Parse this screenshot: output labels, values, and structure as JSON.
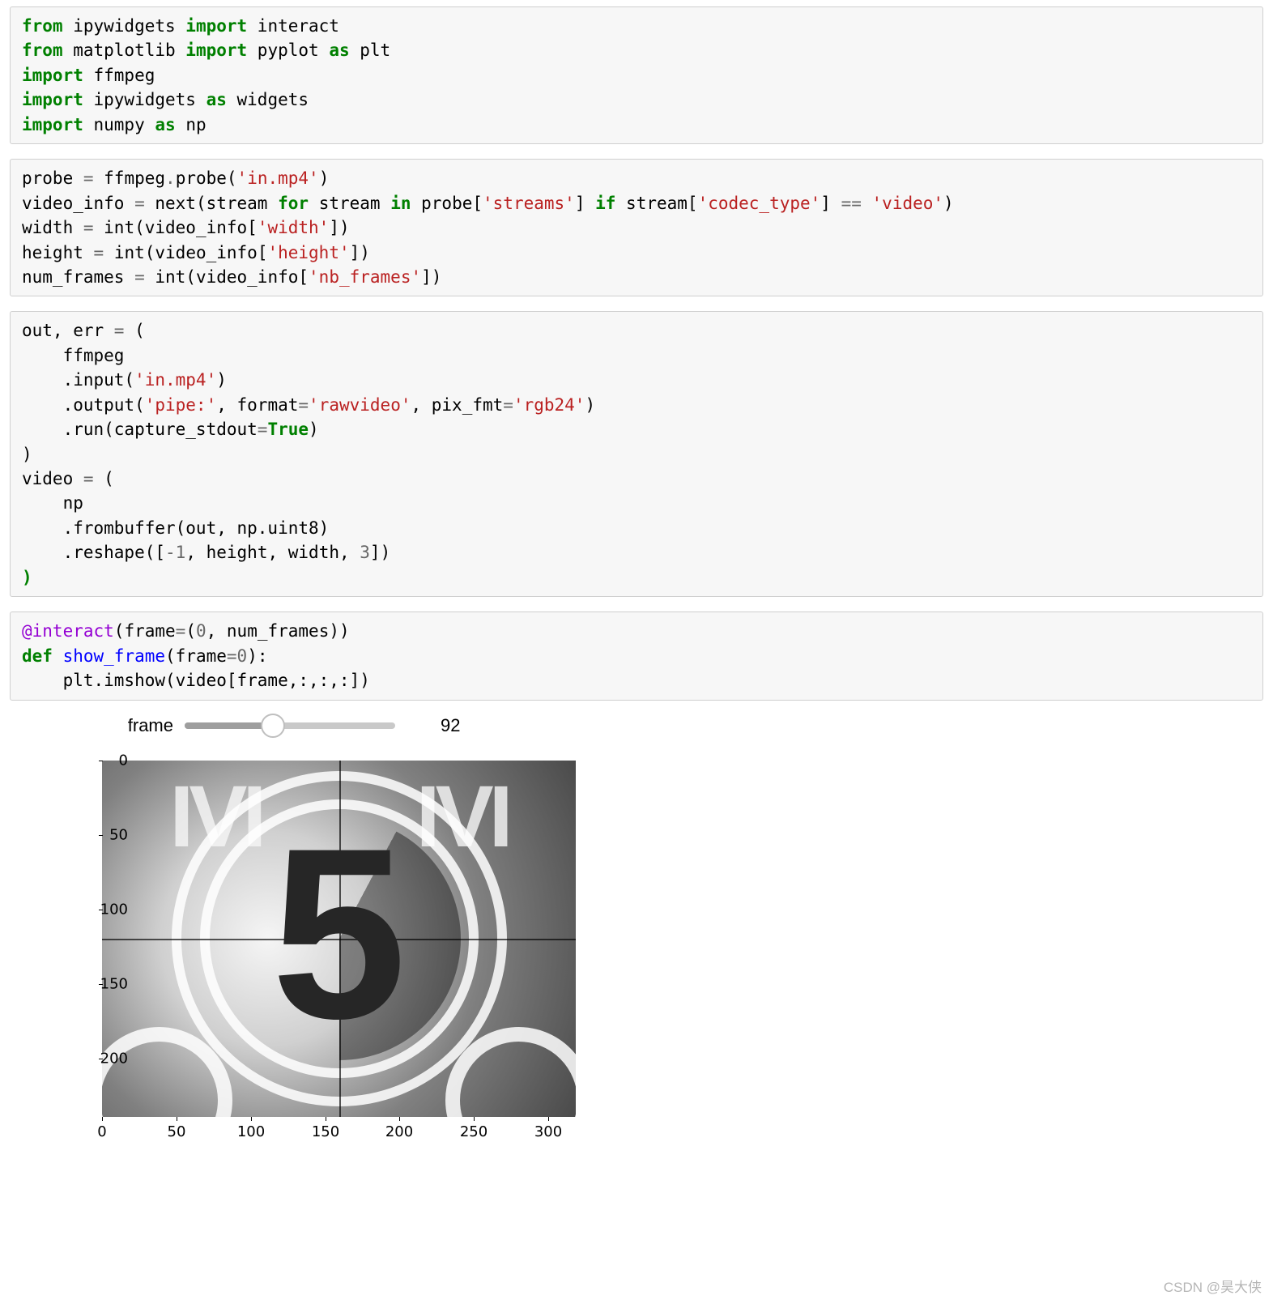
{
  "cells": {
    "c1": {
      "l1": {
        "kw1": "from",
        "m1": " ipywidgets ",
        "kw2": "import",
        "m2": " interact"
      },
      "l2": {
        "kw1": "from",
        "m1": " matplotlib ",
        "kw2": "import",
        "m2": " pyplot ",
        "kw3": "as",
        "m3": " plt"
      },
      "l3": {
        "kw1": "import",
        "m1": " ffmpeg"
      },
      "l4": {
        "kw1": "import",
        "m1": " ipywidgets ",
        "kw2": "as",
        "m2": " widgets"
      },
      "l5": {
        "kw1": "import",
        "m1": " numpy ",
        "kw2": "as",
        "m2": " np"
      }
    },
    "c2": {
      "l1": {
        "a": "probe ",
        "op": "=",
        "b": " ffmpeg",
        "c": ".",
        "d": "probe(",
        "s": "'in.mp4'",
        "e": ")"
      },
      "l2": {
        "a": "video_info ",
        "op": "=",
        "b": " next(stream ",
        "kw1": "for",
        "c": " stream ",
        "kw2": "in",
        "d": " probe[",
        "s1": "'streams'",
        "e": "] ",
        "kw3": "if",
        "f": " stream[",
        "s2": "'codec_type'",
        "g": "] ",
        "op2": "==",
        "h": " ",
        "s3": "'video'",
        "i": ")"
      },
      "l3": {
        "a": "width ",
        "op": "=",
        "b": " int(video_info[",
        "s": "'width'",
        "c": "])"
      },
      "l4": {
        "a": "height ",
        "op": "=",
        "b": " int(video_info[",
        "s": "'height'",
        "c": "])"
      },
      "l5": {
        "a": "num_frames ",
        "op": "=",
        "b": " int(video_info[",
        "s": "'nb_frames'",
        "c": "])"
      }
    },
    "c3": {
      "l1": {
        "a": "out, err ",
        "op": "=",
        "b": " ("
      },
      "l2": {
        "a": "    ffmpeg"
      },
      "l3": {
        "a": "    .input(",
        "s": "'in.mp4'",
        "b": ")"
      },
      "l4": {
        "a": "    .output(",
        "s1": "'pipe:'",
        "b": ", format",
        "op": "=",
        "s2": "'rawvideo'",
        "c": ", pix_fmt",
        "op2": "=",
        "s3": "'rgb24'",
        "d": ")"
      },
      "l5": {
        "a": "    .run(capture_stdout",
        "op": "=",
        "k": "True",
        "b": ")"
      },
      "l6": {
        "a": ")"
      },
      "l7": {
        "a": "video ",
        "op": "=",
        "b": " ("
      },
      "l8": {
        "a": "    np"
      },
      "l9": {
        "a": "    .frombuffer(out, np.uint8)"
      },
      "l10": {
        "a": "    .reshape([",
        "op": "-",
        "n": "1",
        "b": ", height, width, ",
        "n2": "3",
        "c": "])"
      },
      "l11": {
        "a": ")"
      }
    },
    "c4": {
      "l1": {
        "dec": "@interact",
        "a": "(frame",
        "op": "=",
        "b": "(",
        "n1": "0",
        "c": ", num_frames))"
      },
      "l2": {
        "kw": "def",
        "sp": " ",
        "fn": "show_frame",
        "a": "(frame",
        "op": "=",
        "n": "0",
        "b": "):"
      },
      "l3": {
        "a": "    plt.imshow(video[frame,:,:,:])"
      }
    }
  },
  "widget": {
    "label": "frame",
    "value": "92"
  },
  "chart_data": {
    "type": "image",
    "title": "",
    "xlabel": "",
    "ylabel": "",
    "x_ticks": [
      0,
      50,
      100,
      150,
      200,
      250,
      300
    ],
    "y_ticks": [
      0,
      50,
      100,
      150,
      200
    ],
    "xlim": [
      0,
      319
    ],
    "ylim": [
      239,
      0
    ],
    "image_description": "Film countdown leader showing the numeral 5 inside two concentric white rings with crosshair over a greyscale radial background; 'IVI' text in the top-left and top-right corners; partial white circles at bottom corners.",
    "countdown_value": "5",
    "corner_text": "IVI"
  },
  "watermark": "CSDN @昊大侠"
}
